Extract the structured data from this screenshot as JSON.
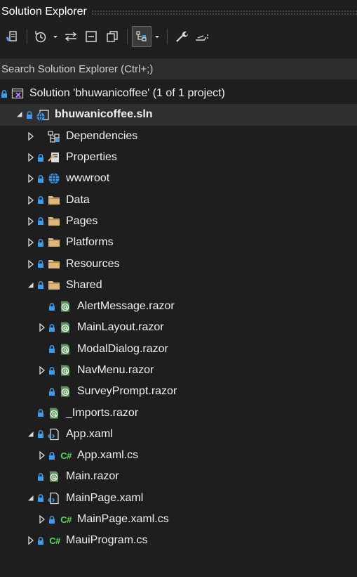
{
  "window": {
    "title": "Solution Explorer"
  },
  "toolbar": {
    "buttons": [
      {
        "name": "switch-views-button",
        "icon": "switch-views-icon"
      },
      {
        "name": "pending-changes-filter-button",
        "icon": "history-clock-icon"
      },
      {
        "name": "pending-changes-dropdown",
        "icon": "chevron-down-icon"
      },
      {
        "name": "sync-with-active-document-button",
        "icon": "sync-arrows-icon"
      },
      {
        "name": "collapse-all-button",
        "icon": "collapse-all-icon"
      },
      {
        "name": "show-all-files-button",
        "icon": "copy-files-icon"
      },
      {
        "name": "show-file-nesting-button",
        "icon": "file-nesting-icon",
        "active": true
      },
      {
        "name": "file-nesting-dropdown",
        "icon": "chevron-down-icon"
      },
      {
        "name": "properties-button",
        "icon": "wrench-icon"
      },
      {
        "name": "preview-selected-items-button",
        "icon": "preview-icon"
      }
    ]
  },
  "search": {
    "placeholder": "Search Solution Explorer (Ctrl+;)",
    "value": ""
  },
  "tree": {
    "items": [
      {
        "label": "Solution 'bhuwanicoffee' (1 of 1 project)",
        "level": 0,
        "twisty": "none",
        "lock": true,
        "icon": "solution-icon"
      },
      {
        "label": "bhuwanicoffee.sln",
        "level": 1,
        "twisty": "expanded",
        "lock": true,
        "icon": "web-project-icon",
        "bold": true,
        "selected": true
      },
      {
        "label": "Dependencies",
        "level": 2,
        "twisty": "collapsed",
        "lock": false,
        "icon": "dependencies-icon"
      },
      {
        "label": "Properties",
        "level": 2,
        "twisty": "collapsed",
        "lock": true,
        "icon": "properties-icon"
      },
      {
        "label": "wwwroot",
        "level": 2,
        "twisty": "collapsed",
        "lock": true,
        "icon": "globe-icon"
      },
      {
        "label": "Data",
        "level": 2,
        "twisty": "collapsed",
        "lock": true,
        "icon": "folder-icon"
      },
      {
        "label": "Pages",
        "level": 2,
        "twisty": "collapsed",
        "lock": true,
        "icon": "folder-icon"
      },
      {
        "label": "Platforms",
        "level": 2,
        "twisty": "collapsed",
        "lock": true,
        "icon": "folder-icon"
      },
      {
        "label": "Resources",
        "level": 2,
        "twisty": "collapsed",
        "lock": true,
        "icon": "folder-icon"
      },
      {
        "label": "Shared",
        "level": 2,
        "twisty": "expanded",
        "lock": true,
        "icon": "folder-icon"
      },
      {
        "label": "AlertMessage.razor",
        "level": 3,
        "twisty": "none",
        "lock": true,
        "icon": "razor-file-icon"
      },
      {
        "label": "MainLayout.razor",
        "level": 3,
        "twisty": "collapsed",
        "lock": true,
        "icon": "razor-file-icon"
      },
      {
        "label": "ModalDialog.razor",
        "level": 3,
        "twisty": "none",
        "lock": true,
        "icon": "razor-file-icon"
      },
      {
        "label": "NavMenu.razor",
        "level": 3,
        "twisty": "collapsed",
        "lock": true,
        "icon": "razor-file-icon"
      },
      {
        "label": "SurveyPrompt.razor",
        "level": 3,
        "twisty": "none",
        "lock": true,
        "icon": "razor-file-icon"
      },
      {
        "label": "_Imports.razor",
        "level": 2,
        "twisty": "none",
        "lock": true,
        "icon": "razor-file-icon"
      },
      {
        "label": "App.xaml",
        "level": 2,
        "twisty": "expanded",
        "lock": true,
        "icon": "xaml-file-icon"
      },
      {
        "label": "App.xaml.cs",
        "level": 3,
        "twisty": "collapsed",
        "lock": true,
        "icon": "csharp-file-icon"
      },
      {
        "label": "Main.razor",
        "level": 2,
        "twisty": "none",
        "lock": true,
        "icon": "razor-file-icon"
      },
      {
        "label": "MainPage.xaml",
        "level": 2,
        "twisty": "expanded",
        "lock": true,
        "icon": "xaml-file-icon"
      },
      {
        "label": "MainPage.xaml.cs",
        "level": 3,
        "twisty": "collapsed",
        "lock": true,
        "icon": "csharp-file-icon"
      },
      {
        "label": "MauiProgram.cs",
        "level": 2,
        "twisty": "collapsed",
        "lock": true,
        "icon": "csharp-file-icon"
      }
    ]
  },
  "colors": {
    "background": "#1e1e1e",
    "selected_row": "#2f2f2f",
    "search_bg": "#2d2d2d",
    "lock": "#3b9cf0",
    "folder": "#dcb67a",
    "csharp": "#57d65c",
    "razor": "#6aae6a"
  }
}
